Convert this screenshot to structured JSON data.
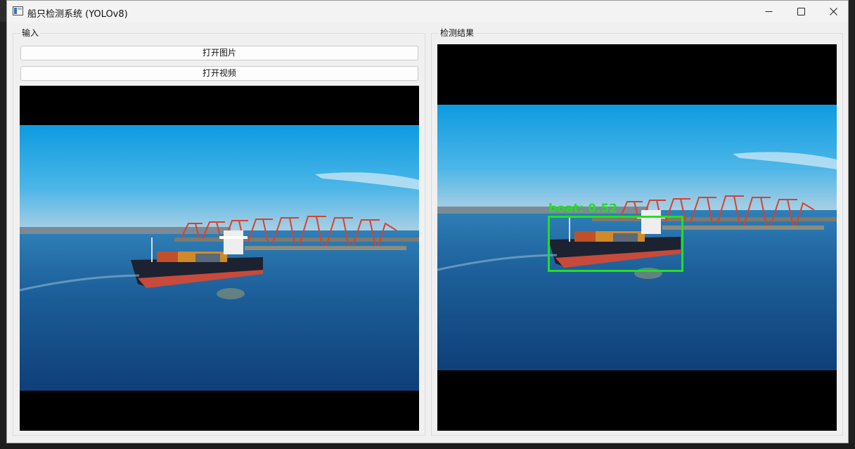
{
  "window": {
    "title": "船只检测系统 (YOLOv8)"
  },
  "input_panel": {
    "title": "输入",
    "open_image_label": "打开图片",
    "open_video_label": "打开视频"
  },
  "output_panel": {
    "title": "检测结果",
    "detection": {
      "label": "boat: 0.52",
      "class": "boat",
      "confidence": 0.52
    }
  },
  "colors": {
    "detection_box": "#22e01f",
    "window_bg": "#f0f0f0",
    "viewer_bg": "#000000"
  },
  "icons": {
    "minimize": "minimize-icon",
    "maximize": "maximize-icon",
    "close": "close-icon",
    "app": "app-window-icon"
  }
}
